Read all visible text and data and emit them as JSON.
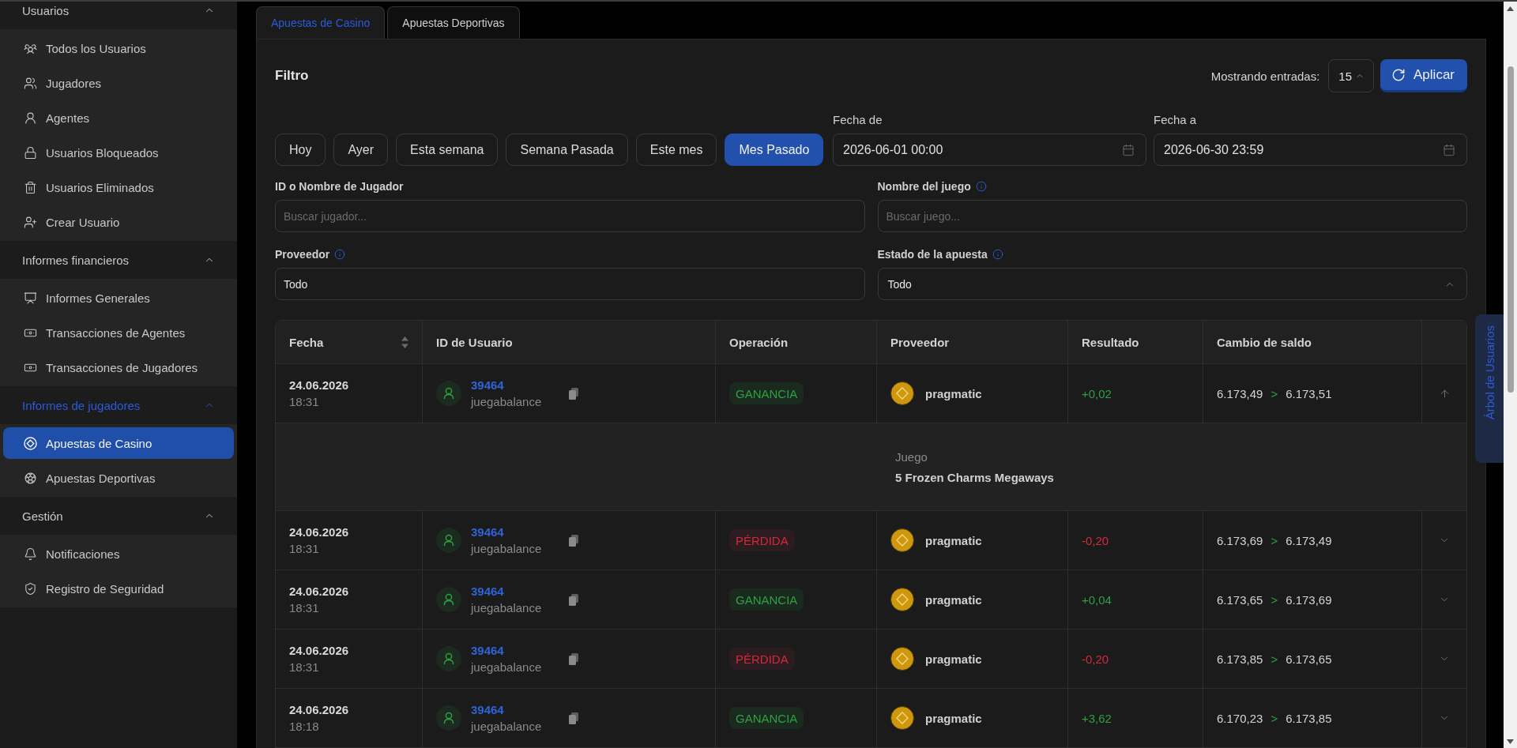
{
  "sidebar": {
    "sections": [
      {
        "title": "Usuarios",
        "expanded": true,
        "items": [
          {
            "label": "Todos los Usuarios",
            "selected": false
          },
          {
            "label": "Jugadores",
            "selected": false
          },
          {
            "label": "Agentes",
            "selected": false
          },
          {
            "label": "Usuarios Bloqueados",
            "selected": false
          },
          {
            "label": "Usuarios Eliminados",
            "selected": false
          },
          {
            "label": "Crear Usuario",
            "selected": false
          }
        ]
      },
      {
        "title": "Informes financieros",
        "expanded": true,
        "items": [
          {
            "label": "Informes Generales",
            "selected": false
          },
          {
            "label": "Transacciones de Agentes",
            "selected": false
          },
          {
            "label": "Transacciones de Jugadores",
            "selected": false
          }
        ]
      },
      {
        "title": "Informes de jugadores",
        "expanded": true,
        "items": [
          {
            "label": "Apuestas de Casino",
            "selected": true
          },
          {
            "label": "Apuestas Deportivas",
            "selected": false
          }
        ]
      },
      {
        "title": "Gestión",
        "expanded": true,
        "items": [
          {
            "label": "Notificaciones",
            "selected": false
          },
          {
            "label": "Registro de Seguridad",
            "selected": false
          }
        ]
      }
    ]
  },
  "tabs": [
    {
      "label": "Apuestas de Casino",
      "selected": true
    },
    {
      "label": "Apuestas Deportivas",
      "selected": false
    }
  ],
  "filter": {
    "title": "Filtro",
    "entries_label": "Mostrando entradas:",
    "entries_value": "15",
    "apply_button": "Aplicar",
    "presets": [
      {
        "label": "Hoy",
        "selected": false
      },
      {
        "label": "Ayer",
        "selected": false
      },
      {
        "label": "Esta semana",
        "selected": false
      },
      {
        "label": "Semana Pasada",
        "selected": false
      },
      {
        "label": "Este mes",
        "selected": false
      },
      {
        "label": "Mes Pasado",
        "selected": true
      }
    ],
    "date_from": {
      "label": "Fecha de",
      "value": "2026-06-01 00:00",
      "kind": "date"
    },
    "date_to": {
      "label": "Fecha a",
      "value": "2026-06-30 23:59",
      "kind": "date"
    },
    "fields": [
      {
        "label": "ID o Nombre de Jugador",
        "placeholder": "Buscar jugador...",
        "kind": "search",
        "info": false
      },
      {
        "label": "Nombre del juego",
        "placeholder": "Buscar juego...",
        "kind": "search",
        "info": true
      },
      {
        "label": "Proveedor",
        "value": "Todo",
        "kind": "text",
        "info": true
      },
      {
        "label": "Estado de la apuesta",
        "value": "Todo",
        "kind": "select",
        "info": true
      }
    ]
  },
  "table": {
    "columns": [
      {
        "label": "Fecha",
        "sortable": true
      },
      {
        "label": "ID de Usuario",
        "sortable": false
      },
      {
        "label": "Operación",
        "sortable": false
      },
      {
        "label": "Proveedor",
        "sortable": false
      },
      {
        "label": "Resultado",
        "sortable": false
      },
      {
        "label": "Cambio de saldo",
        "sortable": false
      }
    ],
    "rows": [
      {
        "date": "24.06.2026",
        "time": "18:31",
        "user_id": "39464",
        "username": "juegabalance",
        "operation": {
          "label": "GANANCIA",
          "kind": "win"
        },
        "provider": "pragmatic",
        "result": "+0,02",
        "balance_change": {
          "from": "6.173,49",
          "arrow": ">",
          "to": "6.173,51"
        },
        "expanded": true,
        "details": [
          {
            "label": "Juego",
            "value": "5 Frozen Charms Megaways"
          }
        ]
      },
      {
        "date": "24.06.2026",
        "time": "18:31",
        "user_id": "39464",
        "username": "juegabalance",
        "operation": {
          "label": "PÉRDIDA",
          "kind": "loss"
        },
        "provider": "pragmatic",
        "result": "-0,20",
        "balance_change": {
          "from": "6.173,69",
          "arrow": ">",
          "to": "6.173,49"
        },
        "expanded": false
      },
      {
        "date": "24.06.2026",
        "time": "18:31",
        "user_id": "39464",
        "username": "juegabalance",
        "operation": {
          "label": "GANANCIA",
          "kind": "win"
        },
        "provider": "pragmatic",
        "result": "+0,04",
        "balance_change": {
          "from": "6.173,65",
          "arrow": ">",
          "to": "6.173,69"
        },
        "expanded": false
      },
      {
        "date": "24.06.2026",
        "time": "18:31",
        "user_id": "39464",
        "username": "juegabalance",
        "operation": {
          "label": "PÉRDIDA",
          "kind": "loss"
        },
        "provider": "pragmatic",
        "result": "-0,20",
        "balance_change": {
          "from": "6.173,85",
          "arrow": ">",
          "to": "6.173,65"
        },
        "expanded": false
      },
      {
        "date": "24.06.2026",
        "time": "18:18",
        "user_id": "39464",
        "username": "juegabalance",
        "operation": {
          "label": "GANANCIA",
          "kind": "win"
        },
        "provider": "pragmatic",
        "result": "+3,62",
        "balance_change": {
          "from": "6.170,23",
          "arrow": ">",
          "to": "6.173,85"
        },
        "expanded": false
      }
    ]
  },
  "side_tab": {
    "label": "Árbol de Usuarios"
  }
}
